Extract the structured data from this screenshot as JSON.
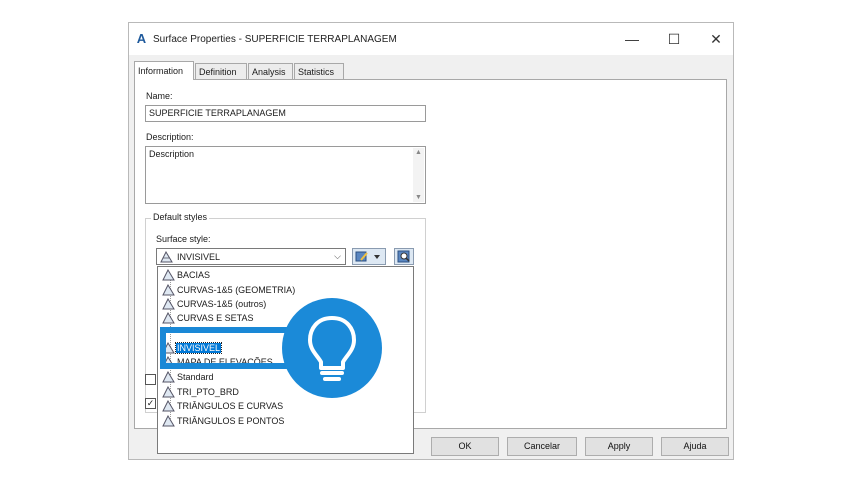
{
  "window": {
    "title": "Surface Properties - SUPERFICIE TERRAPLANAGEM",
    "minimize": "—",
    "maximize": "☐",
    "close": "✕"
  },
  "tabs": [
    {
      "label": "Information",
      "active": true
    },
    {
      "label": "Definition",
      "active": false
    },
    {
      "label": "Analysis",
      "active": false
    },
    {
      "label": "Statistics",
      "active": false
    }
  ],
  "information": {
    "name_label": "Name:",
    "name_value": "SUPERFICIE TERRAPLANAGEM",
    "description_label": "Description:",
    "description_value": "Description",
    "default_styles_label": "Default styles",
    "surface_style_label": "Surface style:",
    "surface_style_value": "INVISIVEL"
  },
  "style_list": [
    {
      "label": "BACIAS",
      "selected": false
    },
    {
      "label": "CURVAS-1&5 (GEOMETRIA)",
      "selected": false
    },
    {
      "label": "CURVAS-1&5 (outros)",
      "selected": false
    },
    {
      "label": "CURVAS E SETAS",
      "selected": false
    },
    {
      "label": "INVISIVEL",
      "selected": true
    },
    {
      "label": "MAPA DE ELEVAÇÕES",
      "selected": false
    },
    {
      "label": "Standard",
      "selected": false
    },
    {
      "label": "TRI_PTO_BRD",
      "selected": false
    },
    {
      "label": "TRIÂNGULOS E CURVAS",
      "selected": false
    },
    {
      "label": "TRIÂNGULOS E PONTOS",
      "selected": false
    }
  ],
  "buttons": {
    "ok": "OK",
    "cancel": "Cancelar",
    "apply": "Apply",
    "help": "Ajuda"
  },
  "colors": {
    "accent": "#1b8ad8",
    "selection": "#0078d7"
  },
  "icons": {
    "app": "civil3d-icon",
    "surface_style": "surface-style-icon",
    "bulb": "lightbulb-icon"
  }
}
